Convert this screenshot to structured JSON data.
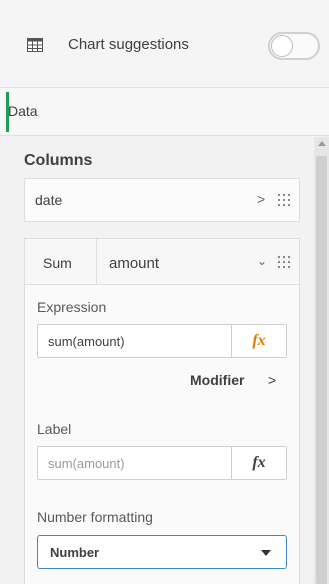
{
  "header": {
    "chart_suggestions_label": "Chart suggestions",
    "toggle_state": "off",
    "icon": "table-icon"
  },
  "tabs": {
    "data_label": "Data"
  },
  "columns": {
    "heading": "Columns",
    "dimension": {
      "label": "date",
      "chevron": ">"
    },
    "measure": {
      "aggregation": "Sum",
      "field": "amount",
      "chevron": "⌄",
      "expression": {
        "label": "Expression",
        "value": "sum(amount)",
        "fx": "fx"
      },
      "modifier": {
        "label": "Modifier",
        "chevron": ">"
      },
      "label_field": {
        "label": "Label",
        "placeholder": "sum(amount)",
        "fx": "fx"
      },
      "number_formatting": {
        "label": "Number formatting",
        "selected": "Number"
      }
    }
  },
  "colors": {
    "accent": "#1d9c5a",
    "focus_border": "#3f88c5"
  }
}
